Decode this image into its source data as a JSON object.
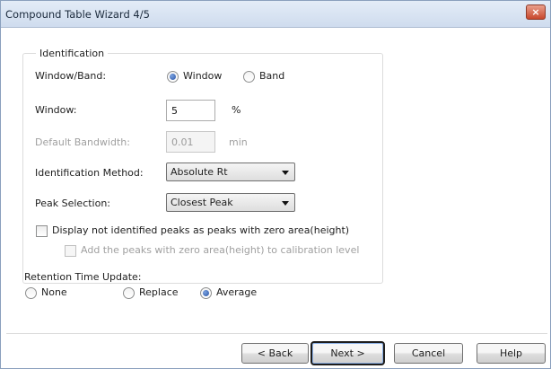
{
  "window": {
    "title": "Compound Table Wizard 4/5",
    "close_glyph": "×"
  },
  "identification": {
    "legend": "Identification",
    "window_band_label": "Window/Band:",
    "option_window": "Window",
    "option_band": "Band",
    "selected": "Window",
    "window_label": "Window:",
    "window_value": "5",
    "window_unit": "%",
    "bandwidth_label": "Default Bandwidth:",
    "bandwidth_value": "0.01",
    "bandwidth_unit": "min",
    "method_label": "Identification Method:",
    "method_value": "Absolute Rt",
    "peak_label": "Peak Selection:",
    "peak_value": "Closest Peak",
    "display_zero_label": "Display not identified peaks as peaks with zero area(height)",
    "display_zero_checked": false,
    "add_calibration_label": "Add the peaks with zero area(height) to calibration level",
    "add_calibration_checked": false
  },
  "retention": {
    "label": "Retention Time Update:",
    "option_none": "None",
    "option_replace": "Replace",
    "option_average": "Average",
    "selected": "Average"
  },
  "buttons": {
    "back": "< Back",
    "next": "Next >",
    "cancel": "Cancel",
    "help": "Help"
  },
  "colors": {
    "accent": "#2a54a6",
    "close": "#c8472c"
  }
}
